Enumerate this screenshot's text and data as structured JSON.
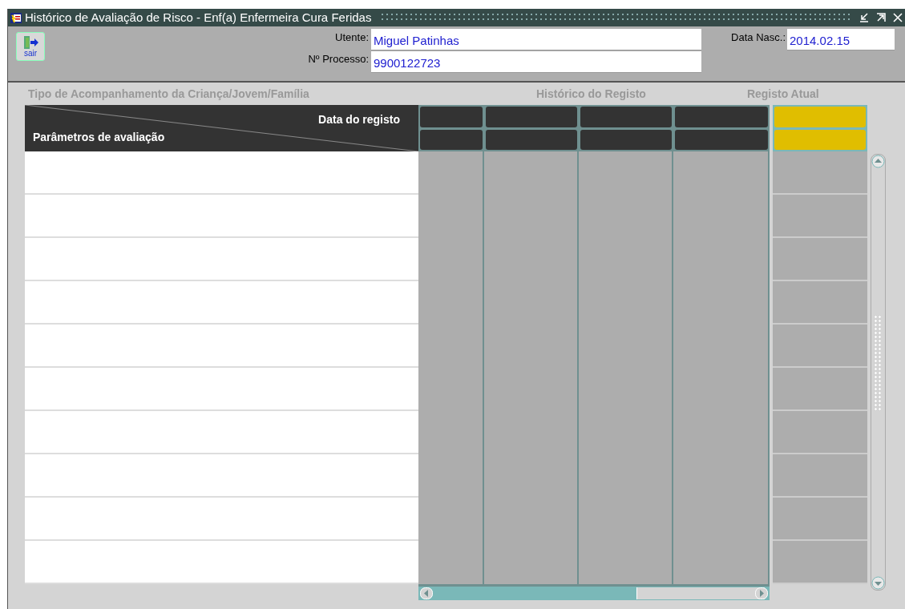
{
  "window": {
    "title": "Histórico de Avaliação de Risco - Enf(a) Enfermeira Cura Feridas"
  },
  "exit_button": {
    "label": "sair"
  },
  "patient": {
    "fields": [
      {
        "label": "Utente:",
        "value": "Miguel Patinhas"
      },
      {
        "label": "Nº Processo:",
        "value": "9900122723"
      },
      {
        "label": "Data Nasc.:",
        "value": "2014.02.15"
      }
    ]
  },
  "section_headings": {
    "left": "Tipo de Acompanhamento da Criança/Jovem/Família",
    "history": "Histórico do Registo",
    "current": "Registo Atual"
  },
  "table": {
    "header_top": "Data do registo",
    "header_bottom": "Parâmetros de avaliação"
  }
}
